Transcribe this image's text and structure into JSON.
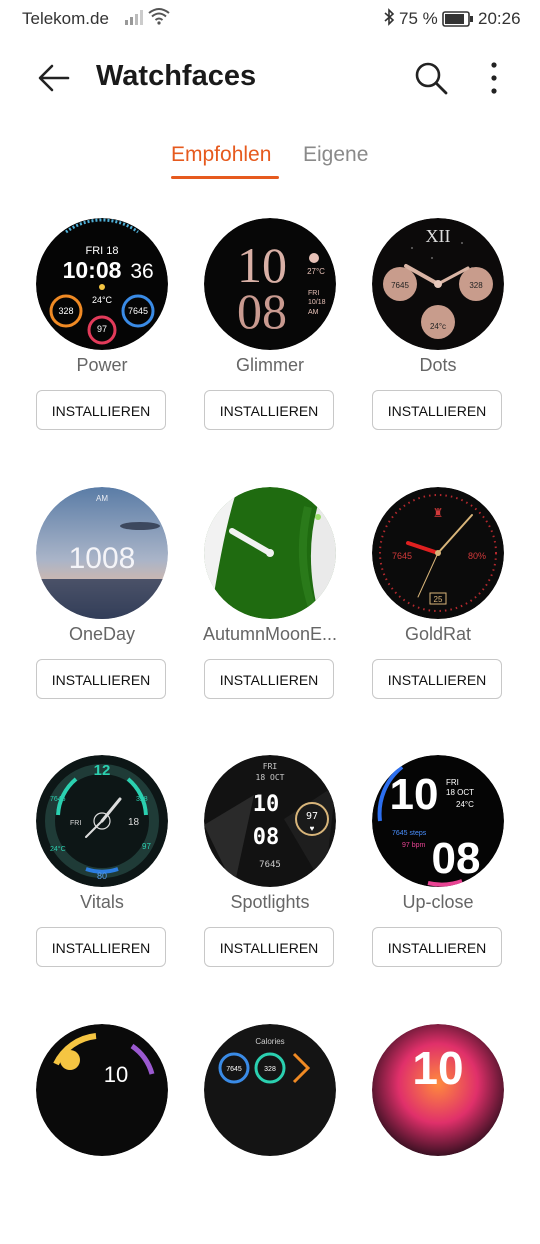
{
  "status_bar": {
    "carrier": "Telekom.de",
    "battery": "75 %",
    "time": "20:26"
  },
  "header": {
    "title": "Watchfaces"
  },
  "tabs": [
    {
      "label": "Empfohlen",
      "active": true
    },
    {
      "label": "Eigene",
      "active": false
    }
  ],
  "accent_color": "#e65a1e",
  "install_label": "INSTALLIEREN",
  "watchfaces": [
    {
      "name": "Power",
      "date": "FRI 18",
      "time": "10:08",
      "seconds": "36",
      "temp": "24°C",
      "left": "328",
      "right": "7645",
      "bottom": "97"
    },
    {
      "name": "Glimmer",
      "hour": "10",
      "minute": "08",
      "temp": "27°C",
      "day": "FRI",
      "date": "10/18",
      "ampm": "AM"
    },
    {
      "name": "Dots",
      "left": "7645",
      "right": "328",
      "bottom": "24°c"
    },
    {
      "name": "OneDay",
      "ampm": "AM",
      "time": "1008"
    },
    {
      "name": "AutumnMoonE..."
    },
    {
      "name": "GoldRat",
      "left": "7645",
      "right": "80%",
      "date": "25"
    },
    {
      "name": "Vitals",
      "hour": "12",
      "left": "7645",
      "right": "328",
      "day": "FRI",
      "date": "18",
      "temp": "24°C",
      "value": "97",
      "bottom": "80"
    },
    {
      "name": "Spotlights",
      "day": "FRI",
      "date": "18 OCT",
      "hour": "10",
      "minute": "08",
      "heart": "97",
      "steps": "7645"
    },
    {
      "name": "Up-close",
      "hour": "10",
      "minute": "08",
      "day": "FRI",
      "date": "18 OCT",
      "temp": "24°C",
      "steps": "7645 steps",
      "bpm": "97 bpm"
    },
    {
      "name": "",
      "time": "10"
    },
    {
      "name": "",
      "title": "Calories",
      "left": "7645",
      "right": "328"
    },
    {
      "name": "",
      "time": "10"
    }
  ]
}
